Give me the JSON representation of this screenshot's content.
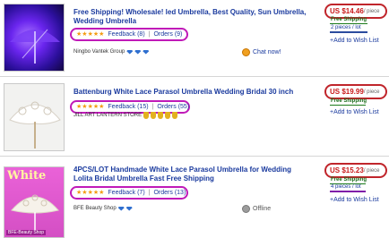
{
  "listings": [
    {
      "title": "Free Shipping! Wholesale! led Umbrella, Best Quality, Sun Umbrella, Wedding Umbrella",
      "feedback": "Feedback (8)",
      "orders": "Orders (9)",
      "seller": "Ningbo Vantek Group",
      "contact": "Chat now!",
      "price": "US $14.46",
      "per_unit": "/ piece",
      "shipping": "Free Shipping",
      "lot": "2 pieces / lot",
      "wishlist": "+Add to Wish List"
    },
    {
      "title": "Battenburg White Lace Parasol Umbrella Wedding Bridal 30 inch",
      "feedback": "Feedback (15)",
      "orders": "Orders (55)",
      "seller": "JILL ART LANTERN STORE",
      "price": "US $19.99",
      "per_unit": "/ piece",
      "shipping": "Free Shipping",
      "wishlist": "+Add to Wish List"
    },
    {
      "title": "4PCS/LOT Handmade White Lace Parasol Umbrella for Wedding Lolita Bridal Umbrella Fast Free Shipping",
      "feedback": "Feedback (7)",
      "orders": "Orders (13)",
      "seller": "BFE Beauty Shop",
      "contact": "Offline",
      "price": "US $15.23",
      "per_unit": "/ piece",
      "shipping": "Free Shipping",
      "lot": "4 pieces / lot",
      "wishlist": "+Add to Wish List",
      "image_text": "White",
      "image_brand": "BFE-Beauty Shop"
    }
  ],
  "colors": {
    "title_link": "#1a3a9e",
    "price": "#c81818",
    "free_shipping": "#1a6b1a",
    "rating_circle": "#c01ab8",
    "price_circle": "#c0252b"
  },
  "icons": {
    "rating": "star-icon",
    "seller_badge_gem": "diamond-icon",
    "seller_badge_medal": "medal-icon",
    "chat": "chat-icon",
    "offline": "offline-icon"
  }
}
